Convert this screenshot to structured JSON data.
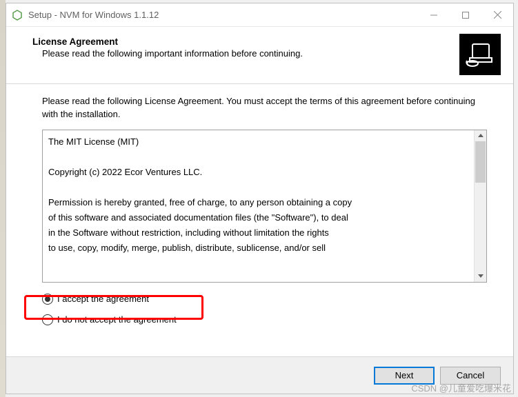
{
  "titlebar": {
    "title": "Setup - NVM for Windows 1.1.12"
  },
  "header": {
    "title": "License Agreement",
    "subtitle": "Please read the following important information before continuing."
  },
  "body": {
    "instruction": "Please read the following License Agreement. You must accept the terms of this agreement before continuing with the installation.",
    "license_text": "The MIT License (MIT)\n\nCopyright (c) 2022 Ecor Ventures LLC.\n\nPermission is hereby granted, free of charge, to any person obtaining a copy\nof this software and associated documentation files (the \"Software\"), to deal\nin the Software without restriction, including without limitation the rights\nto use, copy, modify, merge, publish, distribute, sublicense, and/or sell"
  },
  "radios": {
    "accept": "I accept the agreement",
    "decline": "I do not accept the agreement",
    "selected": "accept"
  },
  "footer": {
    "next": "Next",
    "cancel": "Cancel"
  },
  "watermark": "CSDN @儿童爱吃爆米花"
}
